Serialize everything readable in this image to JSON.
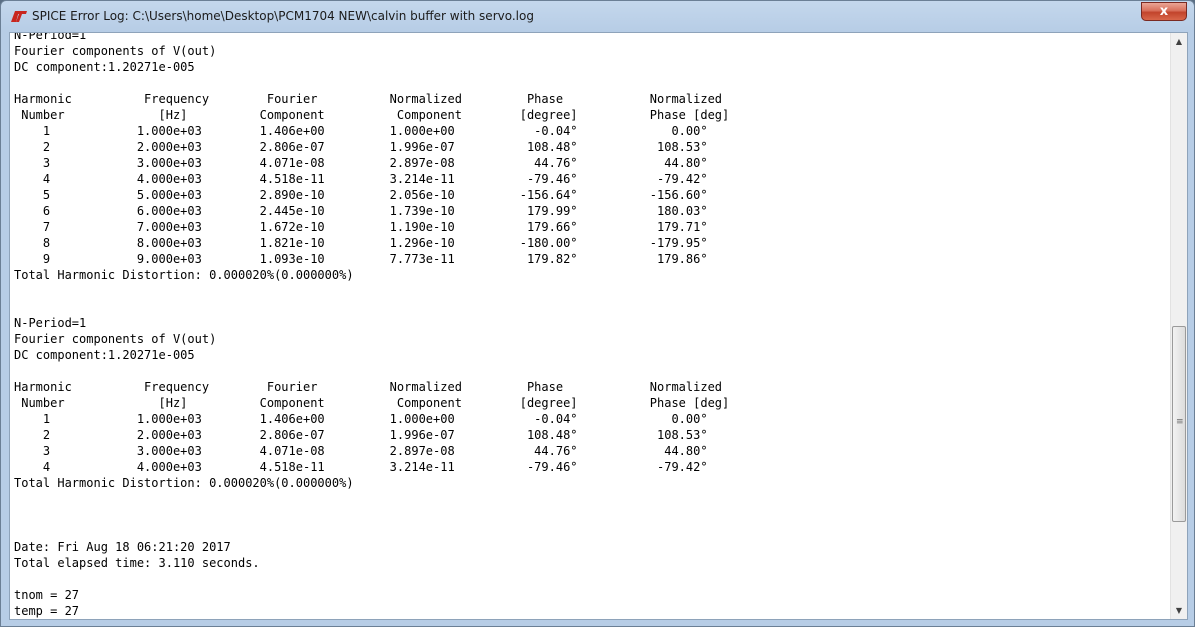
{
  "window": {
    "title": "SPICE Error Log: C:\\Users\\home\\Desktop\\PCM1704 NEW\\calvin buffer with servo.log",
    "close_label": "x",
    "app_icon": "ltspice-logo-icon"
  },
  "log_lines": [
    "N-Period=1",
    "Fourier components of V(out)",
    "DC component:1.20271e-005",
    "",
    "Harmonic          Frequency        Fourier          Normalized         Phase            Normalized",
    " Number             [Hz]          Component          Component        [degree]          Phase [deg]",
    "    1            1.000e+03        1.406e+00         1.000e+00           -0.04°             0.00°",
    "    2            2.000e+03        2.806e-07         1.996e-07          108.48°           108.53°",
    "    3            3.000e+03        4.071e-08         2.897e-08           44.76°            44.80°",
    "    4            4.000e+03        4.518e-11         3.214e-11          -79.46°           -79.42°",
    "    5            5.000e+03        2.890e-10         2.056e-10         -156.64°          -156.60°",
    "    6            6.000e+03        2.445e-10         1.739e-10          179.99°           180.03°",
    "    7            7.000e+03        1.672e-10         1.190e-10          179.66°           179.71°",
    "    8            8.000e+03        1.821e-10         1.296e-10         -180.00°          -179.95°",
    "    9            9.000e+03        1.093e-10         7.773e-11          179.82°           179.86°",
    "Total Harmonic Distortion: 0.000020%(0.000000%)",
    "",
    "",
    "N-Period=1",
    "Fourier components of V(out)",
    "DC component:1.20271e-005",
    "",
    "Harmonic          Frequency        Fourier          Normalized         Phase            Normalized",
    " Number             [Hz]          Component          Component        [degree]          Phase [deg]",
    "    1            1.000e+03        1.406e+00         1.000e+00           -0.04°             0.00°",
    "    2            2.000e+03        2.806e-07         1.996e-07          108.48°           108.53°",
    "    3            3.000e+03        4.071e-08         2.897e-08           44.76°            44.80°",
    "    4            4.000e+03        4.518e-11         3.214e-11          -79.46°           -79.42°",
    "Total Harmonic Distortion: 0.000020%(0.000000%)",
    "",
    "",
    "",
    "Date: Fri Aug 18 06:21:20 2017",
    "Total elapsed time: 3.110 seconds.",
    "",
    "tnom = 27",
    "temp = 27"
  ],
  "scrollbar": {
    "up_icon": "scroll-up-arrow-icon",
    "down_icon": "scroll-down-arrow-icon",
    "grip_icon": "scroll-grip-icon"
  }
}
